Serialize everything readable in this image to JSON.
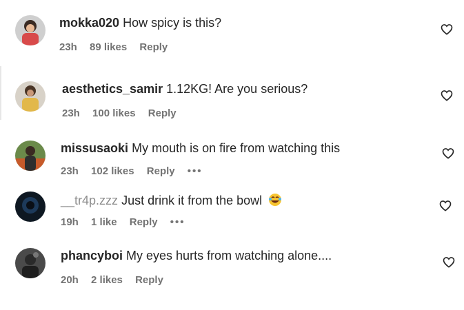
{
  "comments": [
    {
      "username": "mokka020",
      "text": "How spicy is this?",
      "time": "23h",
      "likes": "89 likes",
      "reply": "Reply",
      "more": "",
      "avatar": "avatar-person-red"
    },
    {
      "username": "aesthetics_samir",
      "text": "1.12KG! Are you serious?",
      "time": "23h",
      "likes": "100 likes",
      "reply": "Reply",
      "more": "",
      "avatar": "avatar-person-yellow"
    },
    {
      "username": "missusaoki",
      "text": "My mouth is on fire from watching this",
      "time": "23h",
      "likes": "102 likes",
      "reply": "Reply",
      "more": "•••",
      "avatar": "avatar-person-outdoor"
    },
    {
      "username": "__tr4p.zzz",
      "text": "Just drink it from the bowl",
      "time": "19h",
      "likes": "1 like",
      "reply": "Reply",
      "more": "•••",
      "avatar": "avatar-dark-blue",
      "emoji": "laughing-crying-emoji"
    },
    {
      "username": "phancyboi",
      "text": "My eyes hurts from watching alone....",
      "time": "20h",
      "likes": "2 likes",
      "reply": "Reply",
      "more": "",
      "avatar": "avatar-dark-gray"
    }
  ],
  "icons": {
    "like": "heart-outline-icon"
  },
  "colors": {
    "text": "#262626",
    "meta": "#737373",
    "background": "#ffffff"
  }
}
